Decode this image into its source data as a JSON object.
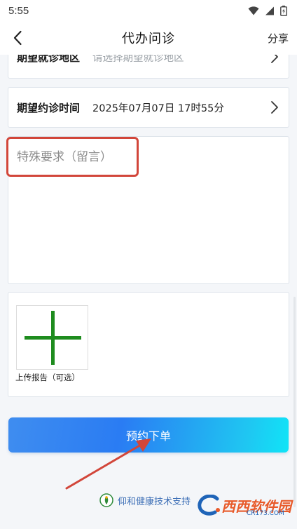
{
  "status_bar": {
    "time": "5:55"
  },
  "header": {
    "title": "代办问诊",
    "share_label": "分享"
  },
  "form": {
    "region": {
      "label": "期望就诊地区",
      "placeholder": "请选择期望就诊地区"
    },
    "appointment_time": {
      "label": "期望约诊时间",
      "value": "2025年07月07日 17时55分"
    },
    "remark": {
      "placeholder": "特殊要求（留言）",
      "value": ""
    },
    "upload": {
      "caption": "上传报告（可选）"
    },
    "submit_label": "预约下单"
  },
  "footer": {
    "support_text": "仰和健康技术支持"
  },
  "watermark": {
    "brand": "西西软件园",
    "domain": "CR173.COM"
  },
  "colors": {
    "primary_gradient_start": "#3f8df0",
    "primary_gradient_end": "#10e4f7",
    "annotation_red": "#d2463a",
    "plus_green": "#1e8c1e",
    "page_background": "#f4f6f9"
  },
  "icons": {
    "back": "chevron-left-icon",
    "row_chevron": "chevron-right-icon",
    "upload": "plus-icon",
    "support_logo": "yanghe-logo-icon"
  }
}
